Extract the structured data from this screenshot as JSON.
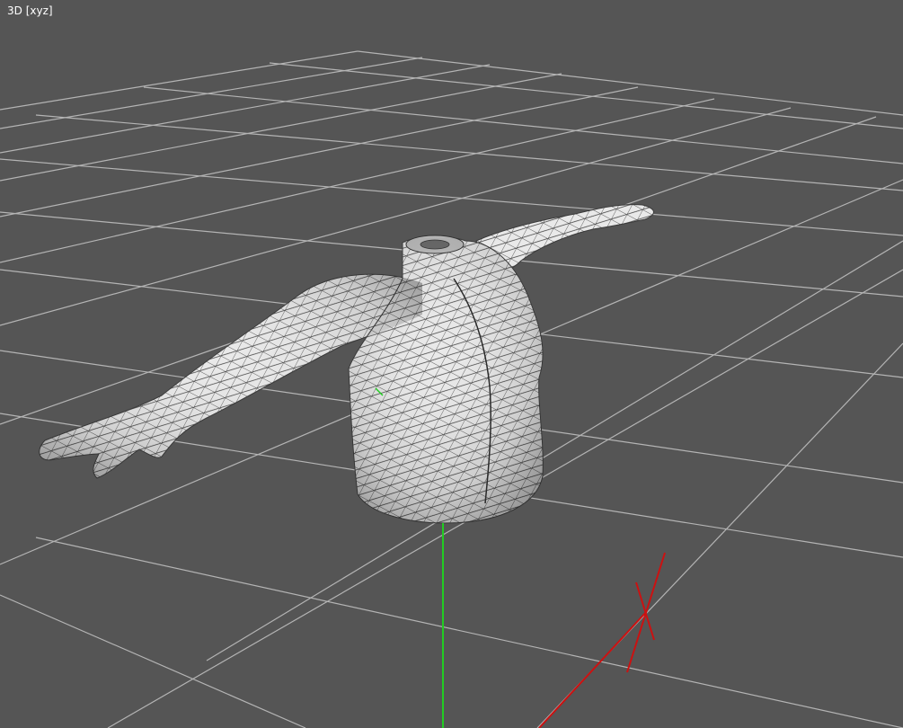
{
  "viewport": {
    "label": "3D [xyz]",
    "background_color": "#555555",
    "grid_color": "#b4b4b4",
    "mesh_color": "#e8e8e8",
    "wire_color": "#2e2e2e",
    "axis_green": "#22cc22",
    "axis_red": "#cc1111"
  }
}
